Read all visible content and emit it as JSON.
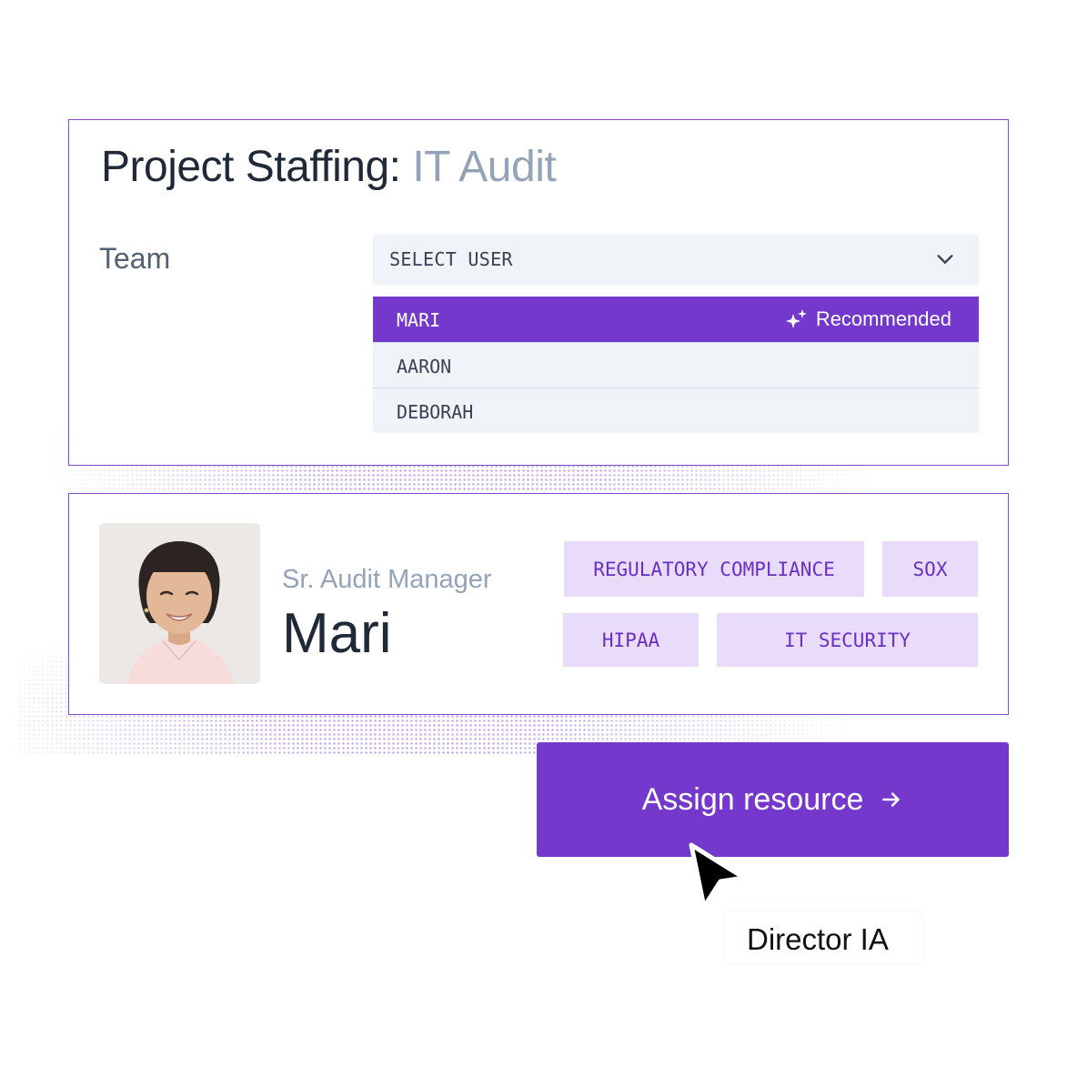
{
  "staffing": {
    "title_main": "Project Staffing:",
    "title_project": "IT Audit",
    "team_label": "Team",
    "select_placeholder": "SELECT USER",
    "options": [
      {
        "label": "MARI",
        "selected": true,
        "badge": "Recommended"
      },
      {
        "label": "AARON",
        "selected": false
      },
      {
        "label": "DEBORAH",
        "selected": false
      }
    ]
  },
  "profile": {
    "role": "Sr. Audit Manager",
    "name": "Mari",
    "skills": [
      "REGULATORY COMPLIANCE",
      "SOX",
      "HIPAA",
      "IT SECURITY"
    ]
  },
  "action": {
    "assign_label": "Assign resource"
  },
  "cursor_user": {
    "label": "Director IA"
  },
  "colors": {
    "accent": "#7438cc",
    "tag_bg": "#e8dcfa",
    "tag_text": "#6a2fc4",
    "muted_text": "#94a3b8",
    "dark_text": "#1f2937",
    "select_bg": "#f0f3f7"
  },
  "icons": {
    "chevron": "chevron-down-icon",
    "sparkle": "sparkle-icon",
    "arrow": "arrow-right-icon",
    "cursor": "mouse-pointer-icon"
  }
}
